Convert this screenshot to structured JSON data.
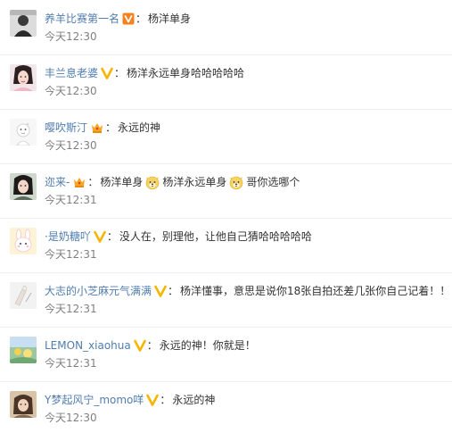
{
  "comments": [
    {
      "user": "养羊比赛第一名",
      "badge": "orange-v-verified",
      "sep": "：",
      "text": "杨洋单身",
      "time": "今天12:30"
    },
    {
      "user": "丰兰息老婆",
      "badge": "yellow-v-verified",
      "sep": "：",
      "text": "杨洋永远单身哈哈哈哈哈",
      "time": "今天12:30"
    },
    {
      "user": "嘤吹斯汀",
      "badge": "crown-icon",
      "sep": "：",
      "text": "永远的神",
      "time": "今天12:30"
    },
    {
      "user": "迩来-",
      "badge": "crown-icon",
      "sep": "：",
      "text_parts": [
        "杨洋单身",
        "杨洋永远单身",
        "哥你选哪个"
      ],
      "emoji": "dog-face-emoji",
      "time": "今天12:31"
    },
    {
      "user": "·是奶糖吖",
      "badge": "yellow-v-verified",
      "sep": "：",
      "text": "没人在，别理他，让他自己猜哈哈哈哈哈",
      "time": "今天12:31"
    },
    {
      "user": "大志的小芝麻元气满满",
      "badge": "yellow-v-verified",
      "sep": "：",
      "text": "杨洋懂事，意思是说你18张自拍还差几张你自己记着！！",
      "time": "今天12:31"
    },
    {
      "user": "LEMON_xiaohua",
      "badge": "yellow-v-verified",
      "sep": "：",
      "text": "永远的神！你就是！",
      "time": "今天12:31"
    },
    {
      "user": "Y梦起风宁_momo咩",
      "badge": "yellow-v-verified",
      "sep": "：",
      "text": "永远的神",
      "time": "今天12:30"
    }
  ],
  "colors": {
    "username": "#507daf",
    "text": "#333333",
    "time": "#808080",
    "divider": "#eeeeee",
    "v_yellow": "#f7b500",
    "v_orange": "#f5821f",
    "crown": "#f6a623"
  }
}
